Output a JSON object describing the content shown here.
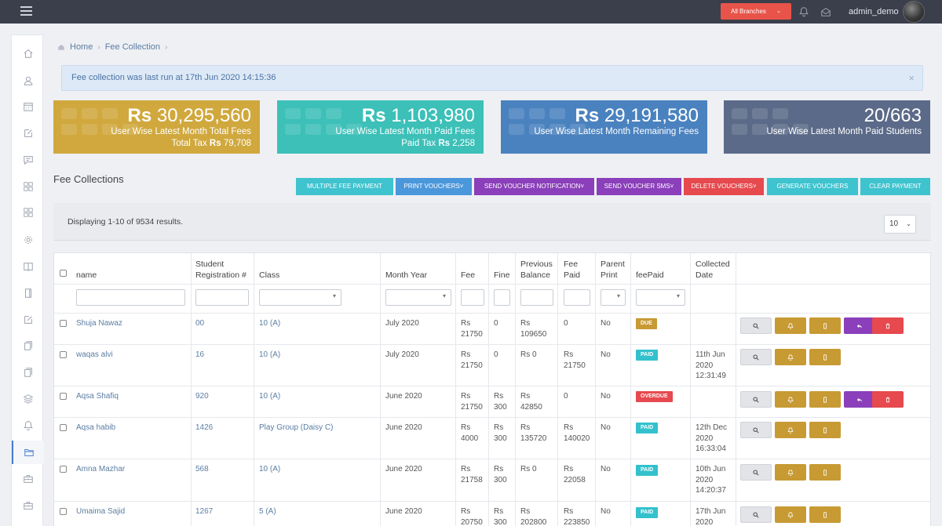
{
  "topbar": {
    "branch_label": "All Branches",
    "admin_name": "admin_demo"
  },
  "breadcrumb": {
    "home": "Home",
    "current": "Fee Collection"
  },
  "alert": {
    "text": "Fee collection was last run at 17th Jun 2020 14:15:36",
    "close": "×"
  },
  "stats": [
    {
      "currency": "Rs",
      "value": "30,295,560",
      "line1": "User Wise Latest Month Total Fees",
      "line2_prefix": "Total Tax",
      "line2_currency": "Rs",
      "line2_value": "79,708",
      "color": "#d0a83d"
    },
    {
      "currency": "Rs",
      "value": "1,103,980",
      "line1": "User Wise Latest Month Paid Fees",
      "line2_prefix": "Paid Tax",
      "line2_currency": "Rs",
      "line2_value": "2,258",
      "color": "#3cc0b8"
    },
    {
      "currency": "Rs",
      "value": "29,191,580",
      "line1": "User Wise Latest Month Remaining Fees",
      "color": "#4a82bf"
    },
    {
      "value": "20/663",
      "line1": "User Wise Latest Month Paid Students",
      "color": "#5b6a88"
    }
  ],
  "section": {
    "title": "Fee Collections",
    "buttons": {
      "multiple": "MULTIPLE FEE PAYMENT",
      "print": "PRINT VOUCHERS",
      "notify": "SEND VOUCHER NOTIFICATION",
      "sms": "SEND VOUCHER SMS",
      "delete": "DELETE VOUCHERS",
      "generate": "GENERATE VOUCHERS",
      "clear": "CLEAR PAYMENT"
    }
  },
  "results": {
    "text": "Displaying 1-10 of 9534 results.",
    "page_size": "10"
  },
  "table": {
    "headers": {
      "name": "name",
      "reg1": "Student",
      "reg2": "Registration #",
      "class": "Class",
      "month": "Month Year",
      "fee": "Fee",
      "fine": "Fine",
      "prev1": "Previous",
      "prev2": "Balance",
      "paid1": "Fee",
      "paid2": "Paid",
      "parent1": "Parent",
      "parent2": "Print",
      "feepaid": "feePaid",
      "coll1": "Collected",
      "coll2": "Date"
    },
    "rows": [
      {
        "name": "Shuja Nawaz",
        "reg": "00",
        "class": "10 (A)",
        "month": "July 2020",
        "fee_cur": "Rs",
        "fee": "21750",
        "fine": "0",
        "fine2": "",
        "prev_cur": "Rs",
        "prev": "109650",
        "paid_cur": "0",
        "paid": "",
        "print": "No",
        "status": "DUE",
        "date1": "",
        "date2": "",
        "date3": ""
      },
      {
        "name": "waqas alvi",
        "reg": "16",
        "class": "10 (A)",
        "month": "July 2020",
        "fee_cur": "Rs",
        "fee": "21750",
        "fine": "0",
        "fine2": "",
        "prev_cur": "Rs 0",
        "prev": "",
        "paid_cur": "Rs",
        "paid": "21750",
        "print": "No",
        "status": "PAID",
        "date1": "11th Jun",
        "date2": "2020",
        "date3": "12:31:49"
      },
      {
        "name": "Aqsa Shafiq",
        "reg": "920",
        "class": "10 (A)",
        "month": "June 2020",
        "fee_cur": "Rs",
        "fee": "21750",
        "fine": "Rs",
        "fine2": "300",
        "prev_cur": "Rs",
        "prev": "42850",
        "paid_cur": "0",
        "paid": "",
        "print": "No",
        "status": "OVERDUE",
        "date1": "",
        "date2": "",
        "date3": ""
      },
      {
        "name": "Aqsa habib",
        "reg": "1426",
        "class": "Play Group (Daisy C)",
        "month": "June 2020",
        "fee_cur": "Rs",
        "fee": "4000",
        "fine": "Rs",
        "fine2": "300",
        "prev_cur": "Rs",
        "prev": "135720",
        "paid_cur": "Rs",
        "paid": "140020",
        "print": "No",
        "status": "PAID",
        "date1": "12th Dec",
        "date2": "2020",
        "date3": "16:33:04"
      },
      {
        "name": "Amna Mazhar",
        "reg": "568",
        "class": "10 (A)",
        "month": "June 2020",
        "fee_cur": "Rs",
        "fee": "21758",
        "fine": "Rs",
        "fine2": "300",
        "prev_cur": "Rs 0",
        "prev": "",
        "paid_cur": "Rs",
        "paid": "22058",
        "print": "No",
        "status": "PAID",
        "date1": "10th Jun",
        "date2": "2020",
        "date3": "14:20:37"
      },
      {
        "name": "Umaima Sajid",
        "reg": "1267",
        "class": "5 (A)",
        "month": "June 2020",
        "fee_cur": "Rs",
        "fee": "20750",
        "fine": "Rs",
        "fine2": "300",
        "prev_cur": "Rs",
        "prev": "202800",
        "paid_cur": "Rs",
        "paid": "223850",
        "print": "No",
        "status": "PAID",
        "date1": "17th Jun",
        "date2": "2020",
        "date3": ""
      }
    ]
  },
  "colors": {
    "accent_blue": "#4b97db",
    "teal": "#3ec3cf",
    "purple": "#8b3fba",
    "red": "#e6494e",
    "gold": "#c79a33"
  }
}
